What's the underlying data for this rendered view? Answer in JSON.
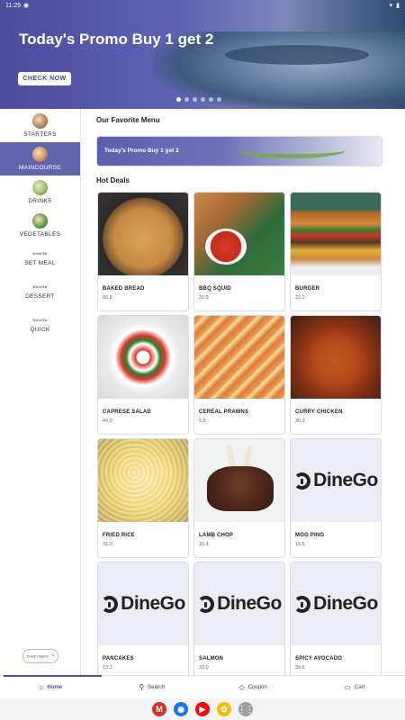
{
  "status_bar": {
    "time": "11:29",
    "left_icon": "app-notification-icon",
    "right_icons": [
      "wifi-icon",
      "battery-icon"
    ]
  },
  "hero": {
    "title": "Today's Promo Buy 1 get 2",
    "button_label": "CHECK NOW",
    "slide_count": 6,
    "active_slide": 1
  },
  "sidebar": {
    "items": [
      {
        "label": "STARTERS",
        "thumb": "starters-thumb",
        "color": "#b08050"
      },
      {
        "label": "MAINCOURSE",
        "thumb": "maincourse-thumb",
        "color": "#c9905c",
        "active": true
      },
      {
        "label": "DRINKS",
        "thumb": "drinks-thumb",
        "color": "#8fbf6a"
      },
      {
        "label": "VEGETABLES",
        "thumb": "vegetables-thumb",
        "color": "#5c9a3c"
      },
      {
        "label": "SET MEAL",
        "tiny": "DineGo"
      },
      {
        "label": "DESSERT",
        "tiny": "DineGo"
      },
      {
        "label": "QUICK",
        "tiny": "DineGo"
      }
    ],
    "take_away_label": "TAKE AWAY"
  },
  "main": {
    "favorite_title": "Our Favorite Menu",
    "promo_banner_text": "Today's Promo Buy 1 get 2",
    "hot_deals_title": "Hot Deals",
    "items": [
      {
        "name": "BAKED BREAD",
        "price": "30.8",
        "img": "bread"
      },
      {
        "name": "BBQ SQUID",
        "price": "20.9",
        "img": "bbq"
      },
      {
        "name": "BURGER",
        "price": "22.0",
        "img": "burger"
      },
      {
        "name": "CAPRESE SALAD",
        "price": "44.0",
        "img": "caprese"
      },
      {
        "name": "CEREAL PRAWNS",
        "price": "5.5",
        "img": "prawn"
      },
      {
        "name": "CURRY CHICKEN",
        "price": "30.3",
        "img": "curry"
      },
      {
        "name": "FRIED RICE",
        "price": "31.0",
        "img": "rice"
      },
      {
        "name": "LAMB CHOP",
        "price": "15.4",
        "img": "lamb"
      },
      {
        "name": "MOO PING",
        "price": "16.5",
        "img": "logo"
      },
      {
        "name": "PANCAKES",
        "price": "13.2",
        "img": "logo"
      },
      {
        "name": "SALMON",
        "price": "33.0",
        "img": "logo"
      },
      {
        "name": "SPICY AVOCADO",
        "price": "39.6",
        "img": "logo"
      }
    ],
    "logo_text": "DineGo"
  },
  "bottom_nav": {
    "items": [
      {
        "label": "Home",
        "icon": "home-icon",
        "glyph": "⌂",
        "active": true
      },
      {
        "label": "Search",
        "icon": "search-icon",
        "glyph": "⚲"
      },
      {
        "label": "Coupon",
        "icon": "coupon-icon",
        "glyph": "◇"
      },
      {
        "label": "Cart",
        "icon": "cart-icon",
        "glyph": "▭"
      }
    ]
  },
  "system_apps": [
    {
      "name": "gmail-icon",
      "glyph": "M",
      "color": "#d93025"
    },
    {
      "name": "chrome-icon",
      "glyph": "◉",
      "color": "#1a73e8"
    },
    {
      "name": "youtube-icon",
      "glyph": "▶",
      "color": "#ff0000"
    },
    {
      "name": "photos-icon",
      "glyph": "✿",
      "color": "#fbbc04"
    },
    {
      "name": "apps-grid-icon",
      "glyph": "⋮⋮",
      "color": "#9e9e9e"
    }
  ]
}
